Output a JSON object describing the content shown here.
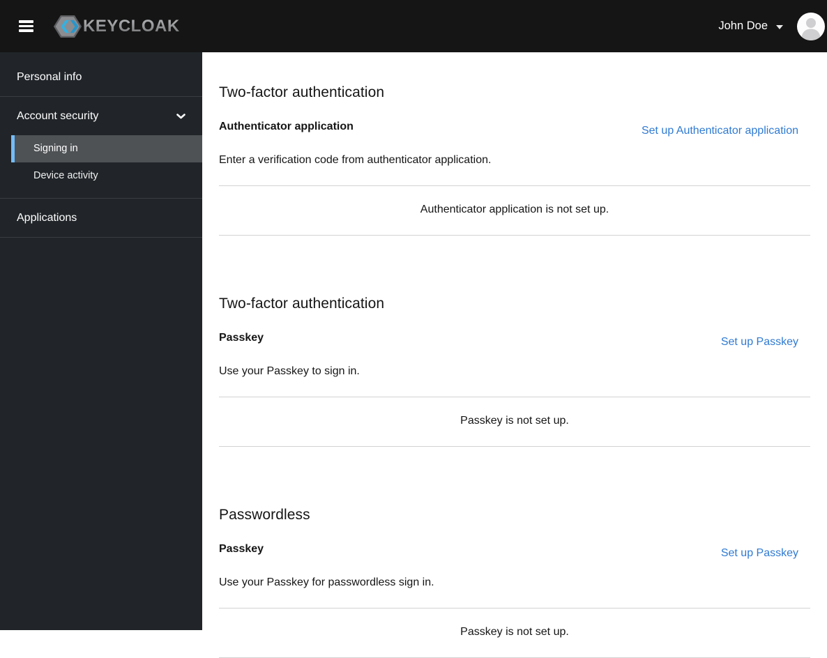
{
  "header": {
    "brand_text": "KEYCLOAK",
    "user": {
      "name": "John Doe"
    }
  },
  "sidebar": {
    "items": [
      {
        "label": "Personal info"
      },
      {
        "label": "Account security",
        "expanded": true,
        "children": [
          {
            "label": "Signing in",
            "current": true
          },
          {
            "label": "Device activity"
          }
        ]
      },
      {
        "label": "Applications"
      }
    ]
  },
  "main": {
    "sections": [
      {
        "heading": "Two-factor authentication",
        "item_title": "Authenticator application",
        "action_label": "Set up Authenticator application",
        "description": "Enter a verification code from authenticator application.",
        "empty_message": "Authenticator application is not set up."
      },
      {
        "heading": "Two-factor authentication",
        "item_title": "Passkey",
        "action_label": "Set up Passkey",
        "description": "Use your Passkey to sign in.",
        "empty_message": "Passkey is not set up."
      },
      {
        "heading": "Passwordless",
        "item_title": "Passkey",
        "action_label": "Set up Passkey",
        "description": "Use your Passkey for passwordless sign in.",
        "empty_message": "Passkey is not set up."
      }
    ]
  },
  "colors": {
    "masthead_bg": "#151515",
    "sidebar_bg": "#212529",
    "nav_current_bg": "#4f5255",
    "nav_current_accent": "#73bcf7",
    "link_blue": "#2f7ad2",
    "divider": "#d2d2d2",
    "logo_cyan": "#33b1e2"
  }
}
